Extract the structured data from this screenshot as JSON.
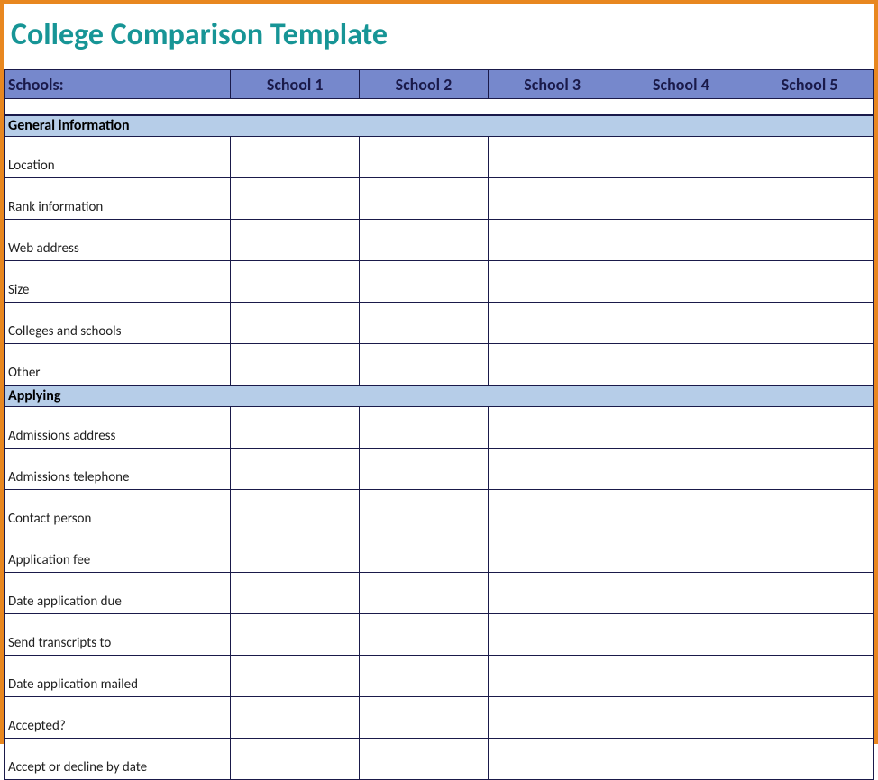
{
  "title": "College Comparison Template",
  "header": {
    "label": "Schools:",
    "columns": [
      "School 1",
      "School 2",
      "School 3",
      "School 4",
      "School 5"
    ]
  },
  "sections": [
    {
      "name": "General information",
      "rows": [
        "Location",
        "Rank information",
        "Web address",
        "Size",
        "Colleges and schools",
        "Other"
      ]
    },
    {
      "name": "Applying",
      "rows": [
        "Admissions address",
        "Admissions telephone",
        "Contact person",
        "Application fee",
        "Date application due",
        "Send transcripts to",
        "Date application mailed",
        "Accepted?",
        "Accept or decline by date"
      ]
    }
  ]
}
